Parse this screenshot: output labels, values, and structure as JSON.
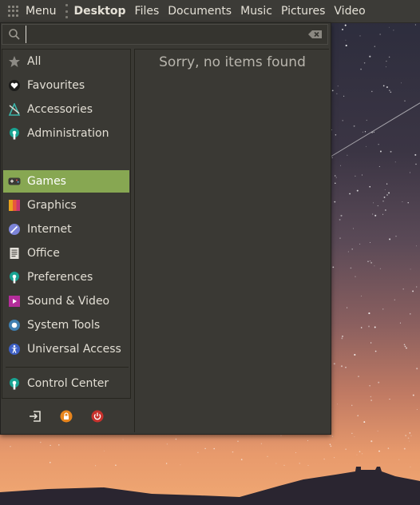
{
  "top_panel": {
    "menu_label": "Menu",
    "places": [
      "Desktop",
      "Files",
      "Documents",
      "Music",
      "Pictures",
      "Video"
    ]
  },
  "search": {
    "value": "",
    "placeholder": ""
  },
  "categories": [
    {
      "label": "All",
      "icon": "star-icon"
    },
    {
      "label": "Favourites",
      "icon": "heart-icon"
    },
    {
      "label": "Accessories",
      "icon": "accessories-icon"
    },
    {
      "label": "Administration",
      "icon": "administration-icon"
    },
    {
      "label": "Games",
      "icon": "gamepad-icon",
      "active": true
    },
    {
      "label": "Graphics",
      "icon": "graphics-icon"
    },
    {
      "label": "Internet",
      "icon": "internet-icon"
    },
    {
      "label": "Office",
      "icon": "office-icon"
    },
    {
      "label": "Preferences",
      "icon": "preferences-icon"
    },
    {
      "label": "Sound & Video",
      "icon": "sound-video-icon"
    },
    {
      "label": "System Tools",
      "icon": "system-tools-icon"
    },
    {
      "label": "Universal Access",
      "icon": "universal-access-icon"
    }
  ],
  "control_center": {
    "label": "Control Center",
    "icon": "control-center-icon"
  },
  "bottom_actions": [
    "logout-icon",
    "lock-icon",
    "power-icon"
  ],
  "results": {
    "empty_message": "Sorry, no items found"
  },
  "colors": {
    "panel": "#3c3b37",
    "menu_bg": "#3a3934",
    "active": "#87a752",
    "power": "#c7312c",
    "lock": "#e8851c"
  }
}
